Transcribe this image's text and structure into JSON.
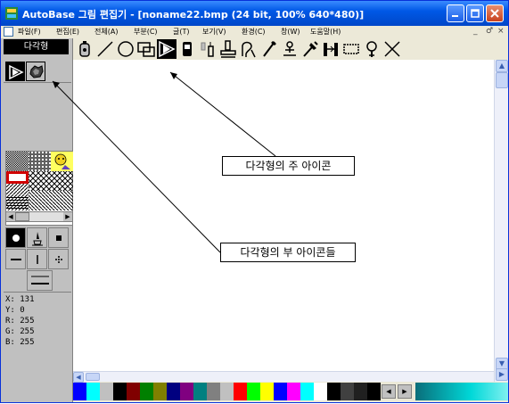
{
  "window": {
    "title": "AutoBase 그림 편집기 - [noname22.bmp (24 bit, 100% 640*480)]",
    "buttons": [
      "minimize",
      "maximize",
      "close"
    ]
  },
  "menubar": {
    "items": [
      "파일(F)",
      "편집(E)",
      "전체(A)",
      "부분(C)",
      "글(T)",
      "보기(V)",
      "환경(C)",
      "창(W)",
      "도움말(H)"
    ],
    "mdi_controls": [
      "_",
      "♂",
      "×"
    ]
  },
  "left_panel": {
    "mode_label": "다각형",
    "coords": {
      "x": "X: 131",
      "y": "Y: 0",
      "r": "R: 255",
      "g": "G: 255",
      "b": "B: 255"
    }
  },
  "toolbar": {
    "tools": [
      "spray-can",
      "line",
      "circle",
      "rectangle",
      "polygon",
      "eraser",
      "brush",
      "stamp",
      "curve",
      "pen",
      "fill",
      "dropper",
      "distance",
      "select-rect",
      "magnify",
      "cancel"
    ],
    "active_tool": "polygon"
  },
  "annotations": {
    "main_icon_label": "다각형의 주 아이콘",
    "sub_icons_label": "다각형의 부 아이콘들"
  },
  "palette": {
    "colors": [
      "#0000ff",
      "#00ffff",
      "#c0c0c0",
      "#000000",
      "#800000",
      "#008000",
      "#808000",
      "#000080",
      "#800080",
      "#008080",
      "#808080",
      "#c0c0c0",
      "#ff0000",
      "#00ff00",
      "#ffff00",
      "#0000ff",
      "#ff00ff",
      "#00ffff",
      "#ffffff",
      "#000000",
      "#404040",
      "#202020",
      "#000000"
    ]
  }
}
